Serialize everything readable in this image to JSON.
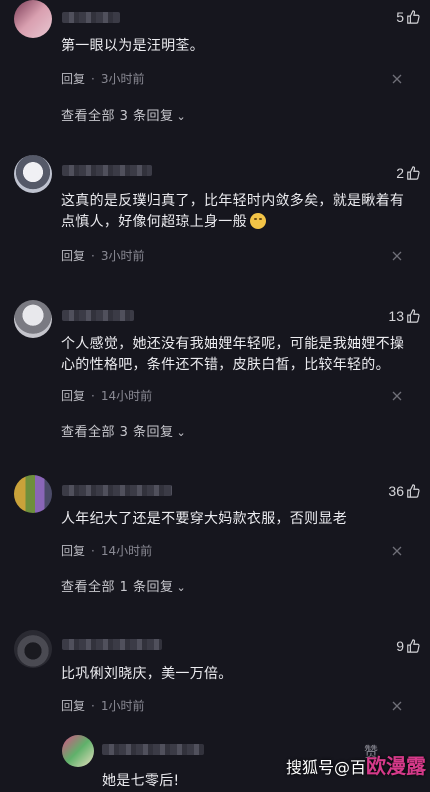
{
  "comments": [
    {
      "likes": "5",
      "text": "第一眼以为是汪明荃。",
      "reply_label": "回复",
      "time": "3小时前",
      "view_more": "查看全部 3 条回复"
    },
    {
      "likes": "2",
      "text": "这真的是反璞归真了，比年轻时内敛多矣，就是瞅着有点慎人，好像何超琼上身一般",
      "reply_label": "回复",
      "time": "3小时前"
    },
    {
      "likes": "13",
      "text": "个人感觉，她还没有我妯娌年轻呢，可能是我妯娌不操心的性格吧，条件还不错，皮肤白皙，比较年轻的。",
      "reply_label": "回复",
      "time": "14小时前",
      "view_more": "查看全部 3 条回复"
    },
    {
      "likes": "36",
      "text": "人年纪大了还是不要穿大妈款衣服，否则显老",
      "reply_label": "回复",
      "time": "14小时前",
      "view_more": "查看全部 1 条回复"
    },
    {
      "likes": "9",
      "text": "比巩俐刘晓庆，美一万倍。",
      "reply_label": "回复",
      "time": "1小时前"
    }
  ],
  "sub_reply": {
    "likes": "赞",
    "text": "她是七零后!"
  },
  "watermark": {
    "prefix": "搜狐号@百",
    "brand": "欧漫露"
  },
  "icons": {
    "like": "thumbs-up-icon",
    "close": "close-icon",
    "chevron": "chevron-down-icon",
    "emoji": "grimace-emoji-icon"
  }
}
